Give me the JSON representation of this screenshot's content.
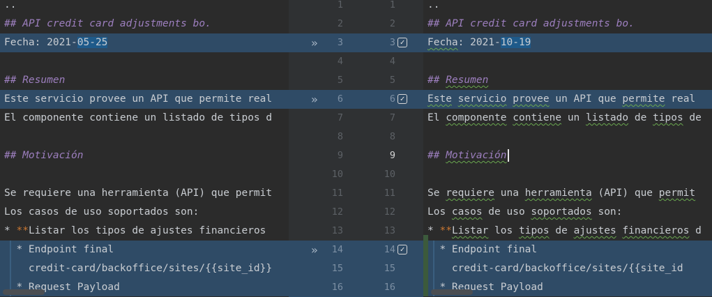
{
  "left_lines": [
    {
      "id": "l1",
      "segments": [
        {
          "t": "..",
          "c": ""
        }
      ]
    },
    {
      "id": "l2",
      "segments": [
        {
          "t": "## API credit card adjustments bo.",
          "c": "comment"
        }
      ]
    },
    {
      "id": "l3",
      "mod": true,
      "segments": [
        {
          "t": "Fecha: 2021-",
          "c": ""
        },
        {
          "t": "05-25",
          "c": "sel"
        }
      ]
    },
    {
      "id": "l4",
      "segments": [
        {
          "t": "",
          "c": ""
        }
      ]
    },
    {
      "id": "l5",
      "segments": [
        {
          "t": "## Resumen",
          "c": "comment"
        }
      ]
    },
    {
      "id": "l6",
      "mod": true,
      "segments": [
        {
          "t": "Este servicio provee un API que permite real",
          "c": ""
        }
      ]
    },
    {
      "id": "l7",
      "segments": [
        {
          "t": "El componente contiene un listado de tipos d",
          "c": ""
        }
      ]
    },
    {
      "id": "l8",
      "segments": [
        {
          "t": "",
          "c": ""
        }
      ]
    },
    {
      "id": "l9",
      "segments": [
        {
          "t": "## Motivación",
          "c": "comment"
        }
      ]
    },
    {
      "id": "l10",
      "segments": [
        {
          "t": "",
          "c": ""
        }
      ]
    },
    {
      "id": "l11",
      "segments": [
        {
          "t": "Se requiere una herramienta (API) que permit",
          "c": ""
        }
      ]
    },
    {
      "id": "l12",
      "segments": [
        {
          "t": "Los casos de uso soportados son:",
          "c": ""
        }
      ]
    },
    {
      "id": "l13",
      "segments": [
        {
          "t": "* ",
          "c": ""
        },
        {
          "t": "**",
          "c": "bold"
        },
        {
          "t": "Listar los tipos de ajustes financieros",
          "c": ""
        }
      ]
    },
    {
      "id": "l14",
      "mod": true,
      "guide": true,
      "segments": [
        {
          "t": "  * Endpoint final",
          "c": ""
        }
      ]
    },
    {
      "id": "l15",
      "mod": true,
      "guide": true,
      "segments": [
        {
          "t": "    credit-card/backoffice/sites/{{site_id}}",
          "c": ""
        }
      ]
    },
    {
      "id": "l16",
      "mod": true,
      "guide": true,
      "segments": [
        {
          "t": "  * Request Payload",
          "c": ""
        }
      ]
    }
  ],
  "right_lines": [
    {
      "id": "r1",
      "segments": [
        {
          "t": "..",
          "c": ""
        }
      ]
    },
    {
      "id": "r2",
      "segments": [
        {
          "t": "## API credit card adjustments bo.",
          "c": "comment"
        }
      ]
    },
    {
      "id": "r3",
      "mod": true,
      "segments": [
        {
          "t": "Fecha",
          "c": "typo"
        },
        {
          "t": ": 2021-",
          "c": ""
        },
        {
          "t": "10-19",
          "c": "sel"
        }
      ]
    },
    {
      "id": "r4",
      "segments": [
        {
          "t": "",
          "c": ""
        }
      ]
    },
    {
      "id": "r5",
      "segments": [
        {
          "t": "## ",
          "c": "comment"
        },
        {
          "t": "Resumen",
          "c": "comment typo"
        }
      ]
    },
    {
      "id": "r6",
      "mod": true,
      "segments": [
        {
          "t": "Este",
          "c": "typo"
        },
        {
          "t": " ",
          "c": ""
        },
        {
          "t": "servicio",
          "c": "typo"
        },
        {
          "t": " ",
          "c": ""
        },
        {
          "t": "provee",
          "c": "typo"
        },
        {
          "t": " un API que ",
          "c": ""
        },
        {
          "t": "permite",
          "c": "typo"
        },
        {
          "t": " real",
          "c": ""
        }
      ]
    },
    {
      "id": "r7",
      "segments": [
        {
          "t": "El ",
          "c": ""
        },
        {
          "t": "componente",
          "c": "typo"
        },
        {
          "t": " ",
          "c": ""
        },
        {
          "t": "contiene",
          "c": "typo"
        },
        {
          "t": " un ",
          "c": ""
        },
        {
          "t": "listado",
          "c": "typo"
        },
        {
          "t": " de ",
          "c": ""
        },
        {
          "t": "tipos",
          "c": "typo"
        },
        {
          "t": " de",
          "c": ""
        }
      ]
    },
    {
      "id": "r8",
      "segments": [
        {
          "t": "",
          "c": ""
        }
      ]
    },
    {
      "id": "r9",
      "caret": true,
      "segments": [
        {
          "t": "## ",
          "c": "comment"
        },
        {
          "t": "Motivación",
          "c": "comment typo"
        }
      ]
    },
    {
      "id": "r10",
      "segments": [
        {
          "t": "",
          "c": ""
        }
      ]
    },
    {
      "id": "r11",
      "segments": [
        {
          "t": "Se ",
          "c": ""
        },
        {
          "t": "requiere",
          "c": "typo"
        },
        {
          "t": " una ",
          "c": ""
        },
        {
          "t": "herramienta",
          "c": "typo"
        },
        {
          "t": " (API) que ",
          "c": ""
        },
        {
          "t": "permit",
          "c": "typo"
        }
      ]
    },
    {
      "id": "r12",
      "segments": [
        {
          "t": "Los ",
          "c": ""
        },
        {
          "t": "casos",
          "c": "typo"
        },
        {
          "t": " de uso ",
          "c": ""
        },
        {
          "t": "soportados",
          "c": "typo"
        },
        {
          "t": " son:",
          "c": ""
        }
      ]
    },
    {
      "id": "r13",
      "segments": [
        {
          "t": "* ",
          "c": ""
        },
        {
          "t": "**",
          "c": "bold"
        },
        {
          "t": "Listar",
          "c": "typo"
        },
        {
          "t": " los ",
          "c": ""
        },
        {
          "t": "tipos",
          "c": "typo"
        },
        {
          "t": " de ",
          "c": ""
        },
        {
          "t": "ajustes",
          "c": "typo"
        },
        {
          "t": " ",
          "c": ""
        },
        {
          "t": "financieros",
          "c": "typo"
        },
        {
          "t": " d",
          "c": ""
        }
      ]
    },
    {
      "id": "r14",
      "mod": true,
      "guide": true,
      "segments": [
        {
          "t": "  * Endpoint final",
          "c": ""
        }
      ]
    },
    {
      "id": "r15",
      "mod": true,
      "guide": true,
      "segments": [
        {
          "t": "    credit-card/backoffice/sites/{{site_id",
          "c": ""
        }
      ]
    },
    {
      "id": "r16",
      "mod": true,
      "guide": true,
      "segments": [
        {
          "t": "  * Request Payload",
          "c": ""
        }
      ]
    }
  ],
  "gutter": [
    {
      "left": "1",
      "right": "1"
    },
    {
      "left": "2",
      "right": "2"
    },
    {
      "left": "3",
      "right": "3",
      "mod": true,
      "chevron": true,
      "check": true
    },
    {
      "left": "4",
      "right": "4"
    },
    {
      "left": "5",
      "right": "5"
    },
    {
      "left": "6",
      "right": "6",
      "mod": true,
      "chevron": true,
      "check": true
    },
    {
      "left": "7",
      "right": "7"
    },
    {
      "left": "8",
      "right": "8"
    },
    {
      "left": "9",
      "right": "9",
      "current": true
    },
    {
      "left": "10",
      "right": "10"
    },
    {
      "left": "11",
      "right": "11"
    },
    {
      "left": "12",
      "right": "12"
    },
    {
      "left": "13",
      "right": "13"
    },
    {
      "left": "14",
      "right": "14",
      "mod": true,
      "chevron": true,
      "check": true
    },
    {
      "left": "15",
      "right": "15",
      "mod": true
    },
    {
      "left": "16",
      "right": "16",
      "mod": true
    }
  ],
  "icons": {
    "chevron": "»",
    "check": "✓"
  },
  "colors": {
    "modified_bg": "#2f4b66",
    "comment": "#9d7fbf",
    "selection": "#1e5a8a"
  }
}
